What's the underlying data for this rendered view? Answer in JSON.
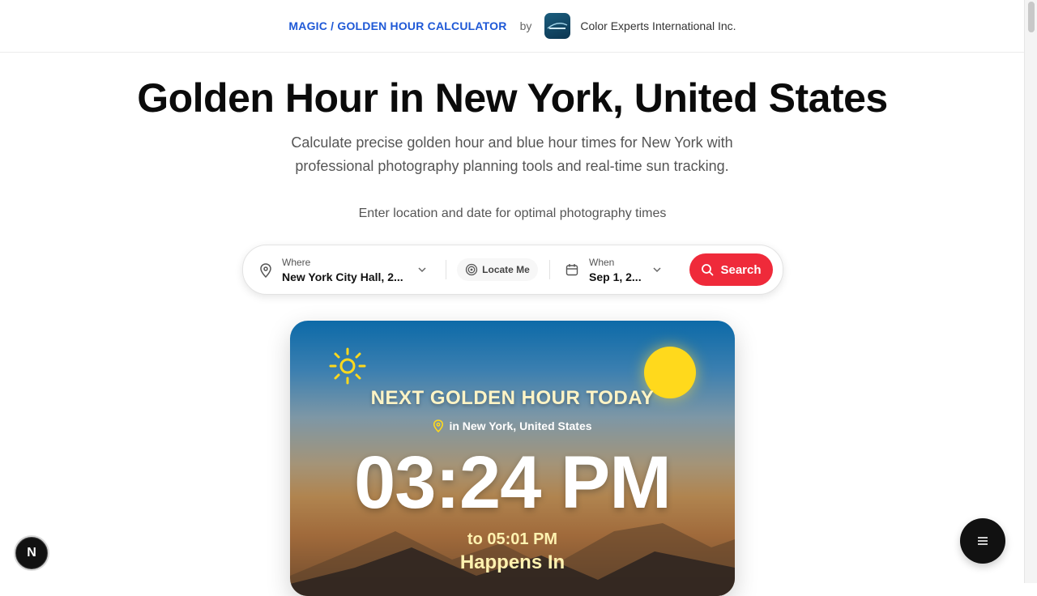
{
  "header": {
    "brand": "MAGIC / GOLDEN HOUR CALCULATOR",
    "by": "by",
    "company": "Color Experts International Inc."
  },
  "hero": {
    "title": "Golden Hour in New York, United States",
    "subtitle": "Calculate precise golden hour and blue hour times for New York with professional photography planning tools and real-time sun tracking.",
    "hint": "Enter location and date for optimal photography times"
  },
  "search": {
    "where_label": "Where",
    "where_value": "New York City Hall, 2...",
    "locate_label": "Locate Me",
    "when_label": "When",
    "when_value": "Sep 1, 2...",
    "button_label": "Search"
  },
  "card": {
    "title": "NEXT GOLDEN HOUR TODAY",
    "location": "in New York, United States",
    "time": "03:24 PM",
    "to": "to 05:01 PM",
    "happens": "Happens In"
  },
  "badge": {
    "letter": "N"
  },
  "icons": [
    "location-pin-icon",
    "chevron-down-icon",
    "target-icon",
    "calendar-icon",
    "search-icon",
    "sun-icon",
    "menu-icon"
  ],
  "colors": {
    "accent_blue": "#1e58d6",
    "search_red": "#ef2a3a",
    "sun_yellow": "#ffd91c"
  }
}
